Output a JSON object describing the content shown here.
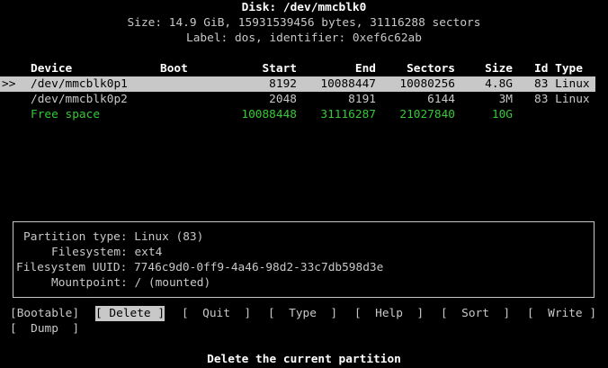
{
  "disk": {
    "title": "Disk: /dev/mmcblk0",
    "size_line": "Size: 14.9 GiB, 15931539456 bytes, 31116288 sectors",
    "label_line": "Label: dos, identifier: 0xef6c62ab"
  },
  "table": {
    "headers": {
      "device": "Device",
      "boot": "Boot",
      "start": "Start",
      "end": "End",
      "sectors": "Sectors",
      "size": "Size",
      "id_type": "Id Type"
    },
    "rows": [
      {
        "marker": ">>",
        "device": "/dev/mmcblk0p1",
        "start": "8192",
        "end": "10088447",
        "sectors": "10080256",
        "size": "4.8G",
        "id_type": "83 Linux"
      },
      {
        "marker": "",
        "device": "/dev/mmcblk0p2",
        "start": "2048",
        "end": "8191",
        "sectors": "6144",
        "size": "3M",
        "id_type": "83 Linux"
      }
    ],
    "free_space": {
      "device": "Free space",
      "start": "10088448",
      "end": "31116287",
      "sectors": "21027840",
      "size": "10G"
    }
  },
  "info": {
    "partition_type": "Partition type: Linux (83)",
    "filesystem": "Filesystem: ext4",
    "uuid": "Filesystem UUID: 7746c9d0-0ff9-4a46-98d2-33c7db598d3e",
    "mountpoint": "Mountpoint: / (mounted)"
  },
  "menu": {
    "bootable": "[Bootable]",
    "delete": "[ Delete ]",
    "quit": "[  Quit  ]",
    "type": "[  Type  ]",
    "help": "[  Help  ]",
    "sort": "[  Sort  ]",
    "write": "[  Write ]",
    "dump": "[  Dump  ]"
  },
  "status": "Delete the current partition",
  "colors": {
    "background": "#000000",
    "text": "#c8c8c8",
    "highlight": "#c8c8c8",
    "free_space": "#37c837"
  }
}
